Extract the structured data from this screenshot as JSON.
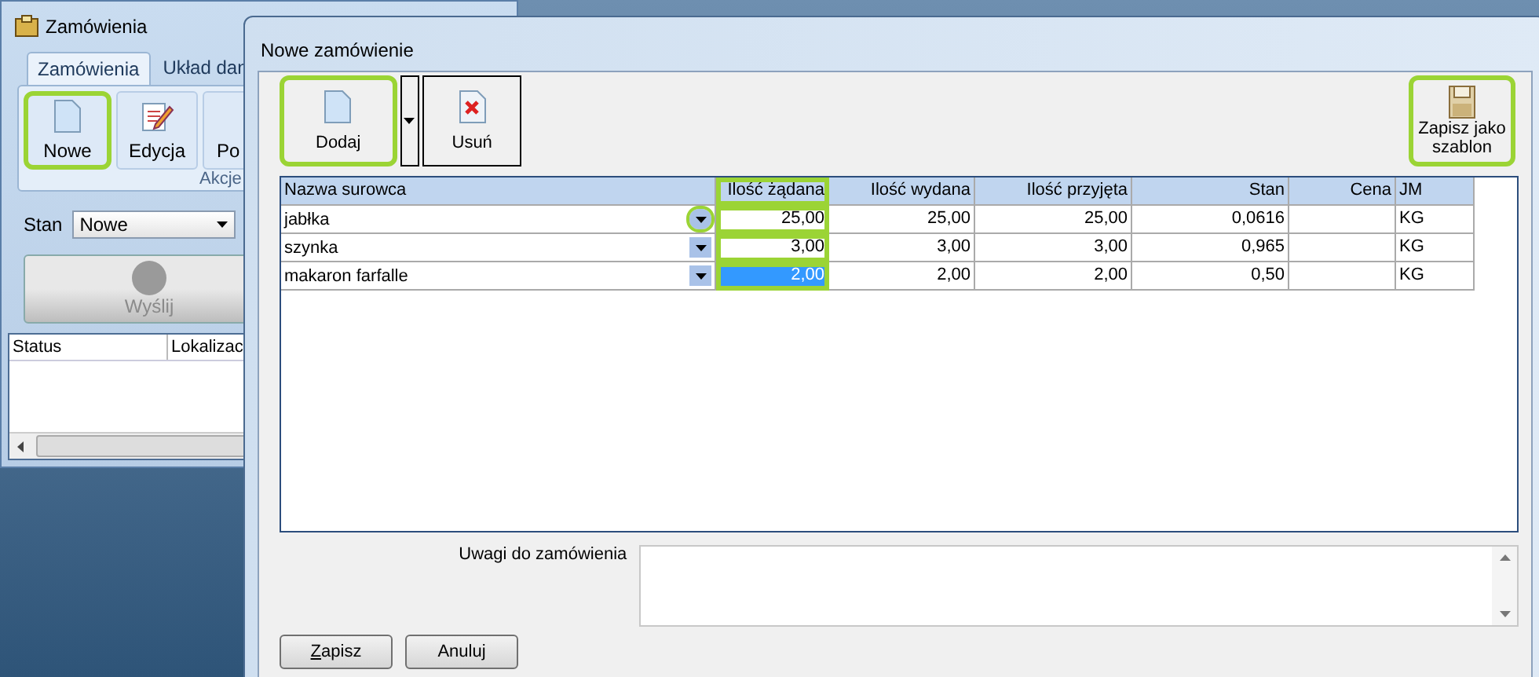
{
  "main_window": {
    "title": "Zamówienia",
    "tabs": [
      {
        "label": "Zamówienia",
        "selected": true
      },
      {
        "label": "Układ dan",
        "selected": false
      }
    ],
    "ribbon_buttons": [
      {
        "label": "Nowe",
        "highlighted": true
      },
      {
        "label": "Edycja",
        "highlighted": false
      },
      {
        "label": "Po",
        "highlighted": false
      }
    ],
    "ribbon_group": "Akcje",
    "filter": {
      "label": "Stan",
      "value": "Nowe"
    },
    "send_button": {
      "label": "Wyślij",
      "disabled": true
    },
    "grid_columns": [
      "Status",
      "Lokalizac"
    ]
  },
  "dialog": {
    "title": "Nowe zamówienie",
    "toolbar": [
      {
        "label": "Dodaj",
        "highlighted": true,
        "has_menu": true
      },
      {
        "label": "Usuń",
        "highlighted": false,
        "has_menu": false
      }
    ],
    "template_button": {
      "label": "Zapisz jako szablon",
      "highlighted": true
    },
    "table": {
      "columns": [
        {
          "label": "Nazwa surowca",
          "highlighted": false
        },
        {
          "label": "Ilość żądana",
          "highlighted": true
        },
        {
          "label": "Ilość wydana",
          "highlighted": false
        },
        {
          "label": "Ilość przyjęta",
          "highlighted": false
        },
        {
          "label": "Stan",
          "highlighted": false
        },
        {
          "label": "Cena",
          "highlighted": false
        },
        {
          "label": "JM",
          "highlighted": false
        }
      ],
      "rows": [
        {
          "cells": [
            "jabłka",
            "25,00",
            "25,00",
            "25,00",
            "0,0616",
            "",
            "KG"
          ],
          "dropdown_highlighted": true,
          "selected": false
        },
        {
          "cells": [
            "szynka",
            "3,00",
            "3,00",
            "3,00",
            "0,965",
            "",
            "KG"
          ],
          "dropdown_highlighted": false,
          "selected": false
        },
        {
          "cells": [
            "makaron farfalle",
            "2,00",
            "2,00",
            "2,00",
            "0,50",
            "",
            "KG"
          ],
          "dropdown_highlighted": false,
          "selected": true
        }
      ]
    },
    "notes": {
      "label": "Uwagi do zamówienia"
    },
    "buttons": [
      {
        "label": "Zapisz",
        "access_key": true
      },
      {
        "label": "Anuluj",
        "access_key": false
      }
    ]
  }
}
